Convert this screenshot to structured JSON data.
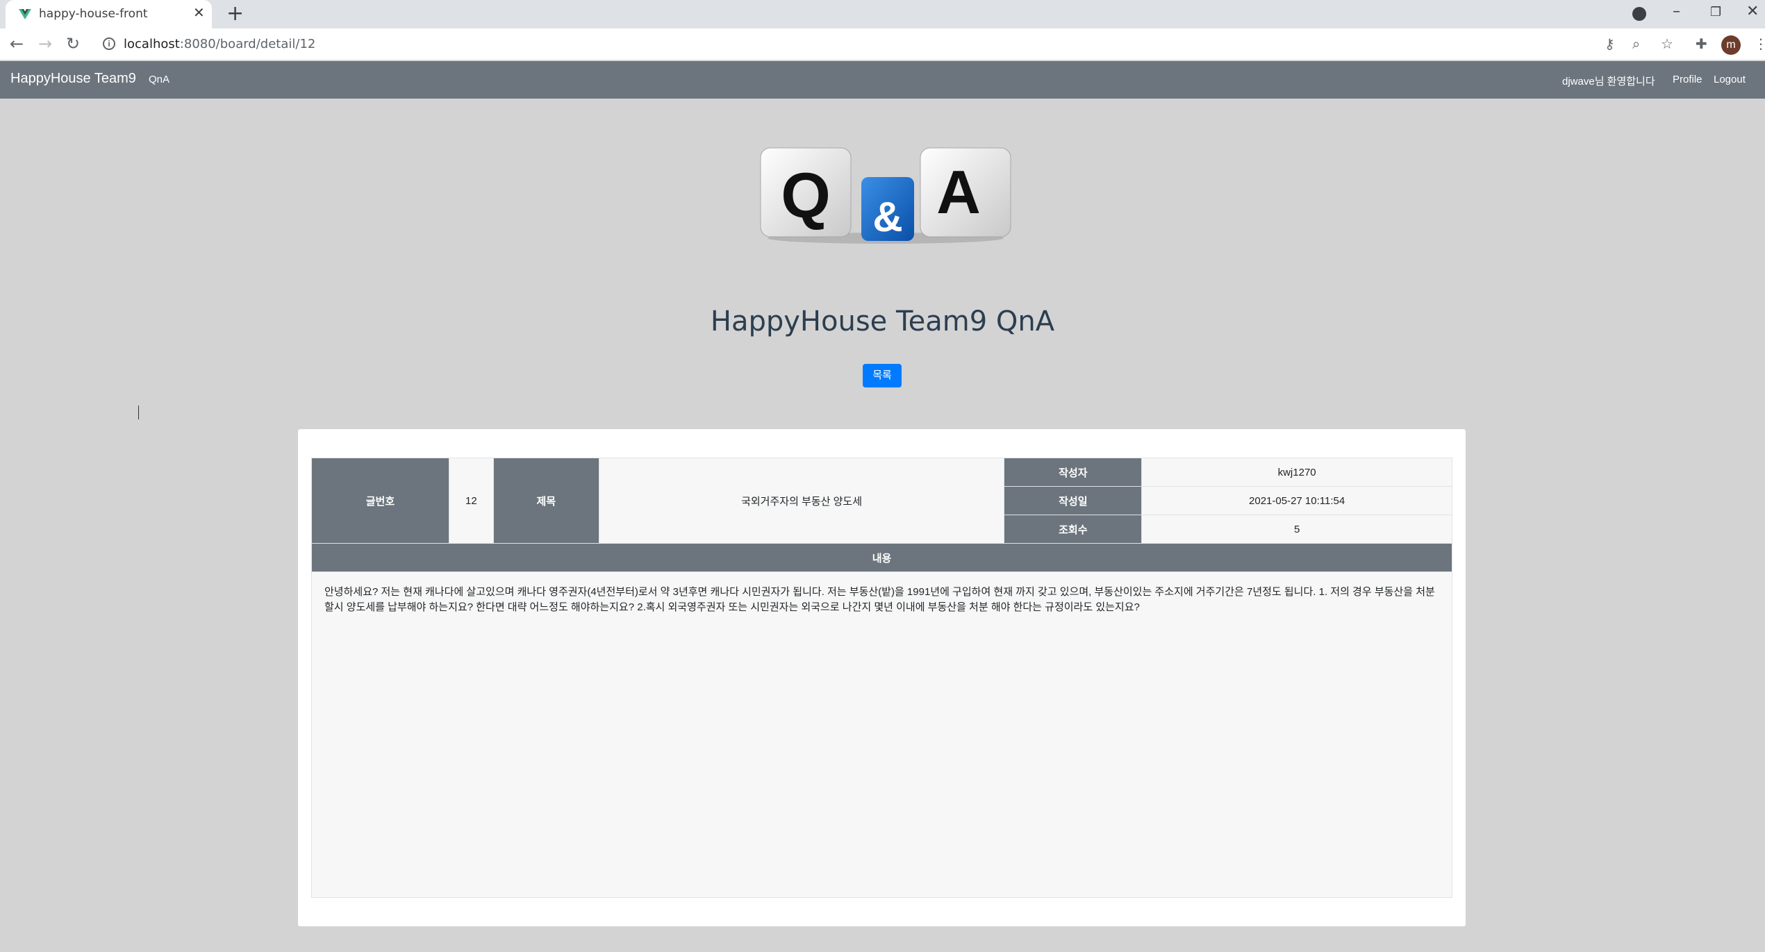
{
  "browser": {
    "tab_title": "happy-house-front",
    "url_host": "localhost",
    "url_rest": ":8080/board/detail/12",
    "profile_initial": "m"
  },
  "navbar": {
    "brand": "HappyHouse Team9",
    "qna_link": "QnA",
    "welcome": "djwave님 환영합니다",
    "profile_link": "Profile",
    "logout_link": "Logout"
  },
  "hero": {
    "dice": [
      "Q",
      "&",
      "A"
    ]
  },
  "page": {
    "title": "HappyHouse Team9 QnA",
    "list_button": "목록"
  },
  "detail": {
    "no_label": "글번호",
    "no_value": "12",
    "subject_label": "제목",
    "subject_value": "국외거주자의 부동산 양도세",
    "writer_label": "작성자",
    "writer_value": "kwj1270",
    "date_label": "작성일",
    "date_value": "2021-05-27 10:11:54",
    "hit_label": "조회수",
    "hit_value": "5",
    "content_label": "내용",
    "content_value": "안녕하세요? 저는 현재 캐나다에 살고있으며 캐나다 영주권자(4년전부터)로서 약 3년후면 캐나다 시민권자가 됩니다. 저는 부동산(밭)을 1991년에 구입하여 현재 까지 갖고 있으며, 부동산이있는 주소지에 거주기간은 7년정도 됩니다. 1. 저의 경우 부동산을 처분할시 양도세를 납부해야 하는지요? 한다면 대략 어느정도 해야하는지요? 2.혹시 외국영주권자 또는 시민권자는 외국으로 나간지 몇년 이내에 부동산을 처분 해야 한다는 규정이라도 있는지요?"
  }
}
